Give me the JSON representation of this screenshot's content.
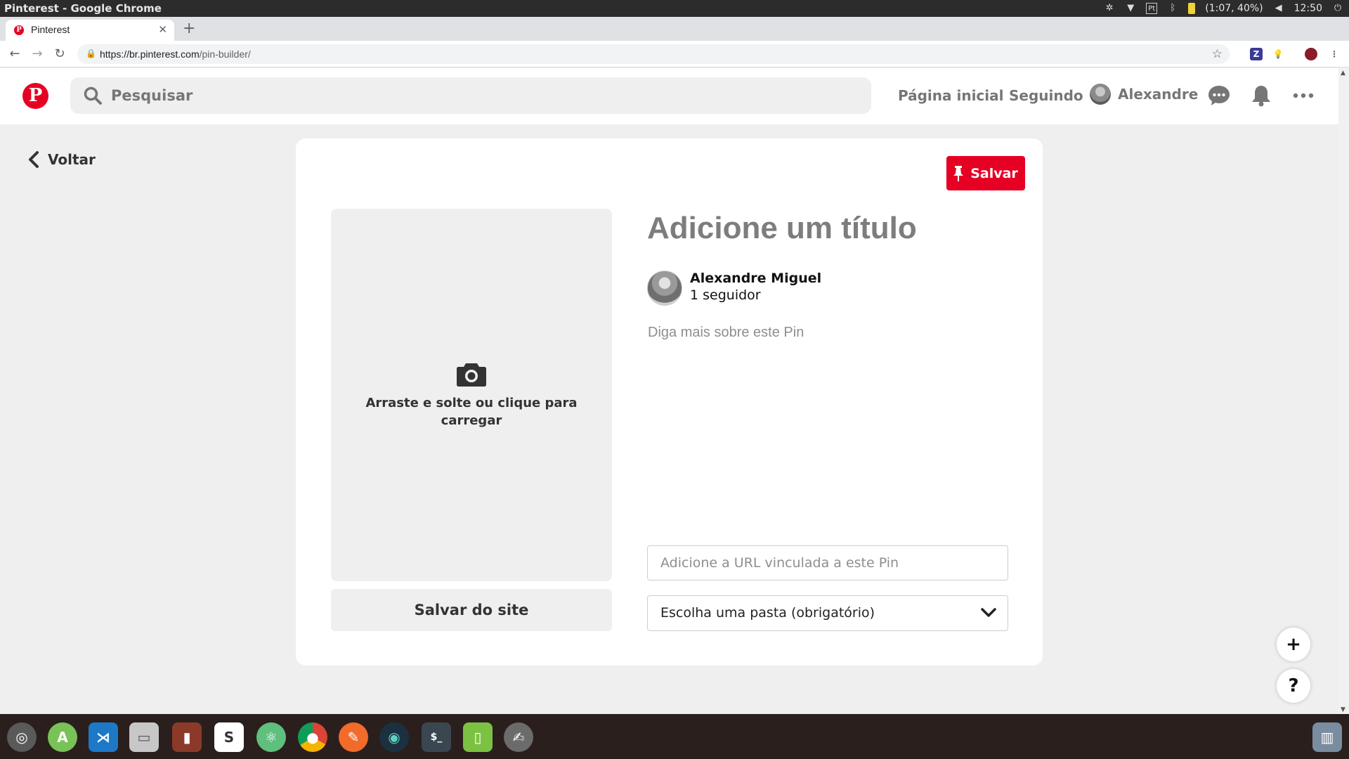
{
  "os": {
    "window_title": "Pinterest - Google Chrome",
    "battery_text": "(1:07, 40%)",
    "clock": "12:50"
  },
  "browser": {
    "tab_title": "Pinterest",
    "url_host": "https://br.pinterest.com",
    "url_path": "/pin-builder/"
  },
  "header": {
    "search_placeholder": "Pesquisar",
    "home_label": "Página inicial",
    "following_label": "Seguindo",
    "user_name": "Alexandre"
  },
  "page": {
    "back_label": "Voltar",
    "save_label": "Salvar",
    "dropzone_text": "Arraste e solte ou clique para carregar",
    "save_from_site_label": "Salvar do site",
    "title_placeholder": "Adicione um título",
    "author_name": "Alexandre Miguel",
    "author_followers": "1 seguidor",
    "description_placeholder": "Diga mais sobre este Pin",
    "url_placeholder": "Adicione a URL vinculada a este Pin",
    "board_select_label": "Escolha uma pasta (obrigatório)"
  },
  "floating": {
    "add_label": "+",
    "help_label": "?"
  },
  "colors": {
    "brand": "#e60023",
    "page_bg": "#efefef"
  },
  "dock": {
    "apps": [
      "ubuntu-dash",
      "android-studio",
      "vscode",
      "files",
      "book-reader",
      "slack",
      "atom",
      "chrome",
      "postman",
      "gitkraken",
      "terminal",
      "tablet-app",
      "gimp"
    ]
  }
}
